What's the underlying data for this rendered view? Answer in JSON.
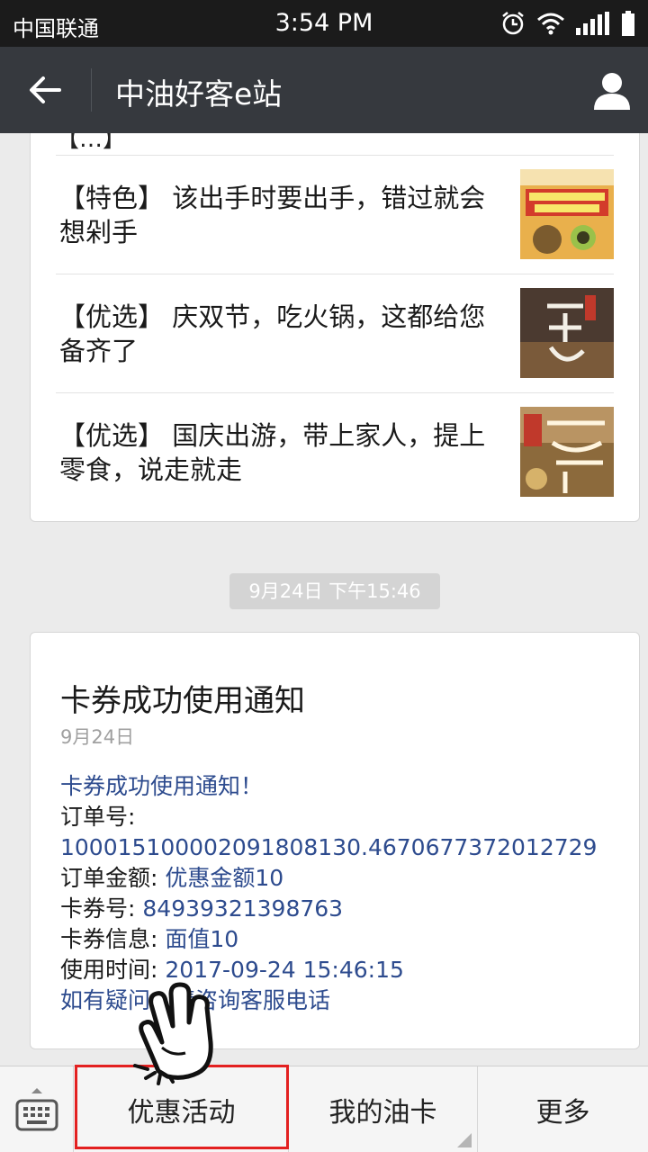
{
  "status_bar": {
    "carrier": "中国联通",
    "time": "3:54 PM"
  },
  "header": {
    "title": "中油好客e站"
  },
  "article_card": {
    "cut_text": "【…】",
    "items": [
      {
        "text": "【特色】 该出手时要出手，错过就会想剁手"
      },
      {
        "text": "【优选】 庆双节，吃火锅，这都给您备齐了"
      },
      {
        "text": "【优选】 国庆出游，带上家人，提上零食，说走就走"
      }
    ]
  },
  "timestamp": "9月24日 下午15:46",
  "notice": {
    "title": "卡券成功使用通知",
    "date": "9月24日",
    "heading": "卡券成功使用通知！",
    "order_no_label": "订单号:",
    "order_no_value": "100015100002091808130.4670677372012729",
    "amount_label": "订单金额:",
    "amount_value": "优惠金额10",
    "coupon_no_label": "卡券号:",
    "coupon_no_value": "84939321398763",
    "coupon_info_label": "卡券信息:",
    "coupon_info_value": "面值10",
    "use_time_label": "使用时间:",
    "use_time_value": "2017-09-24 15:46:15",
    "footer": "如有疑问，请咨询客服电话"
  },
  "bottom_menu": {
    "items": [
      {
        "label": "优惠活动"
      },
      {
        "label": "我的油卡"
      },
      {
        "label": "更多"
      }
    ]
  },
  "colors": {
    "header_bg": "#36393e",
    "status_bg": "#1b1b1b",
    "link_blue": "#2d4b8e",
    "highlight_red": "#e32020"
  },
  "icons": {
    "back": "arrow-left-icon",
    "profile": "person-icon",
    "keyboard": "keyboard-icon",
    "alarm": "alarm-icon",
    "wifi": "wifi-icon",
    "signal": "signal-icon",
    "battery": "battery-icon"
  }
}
